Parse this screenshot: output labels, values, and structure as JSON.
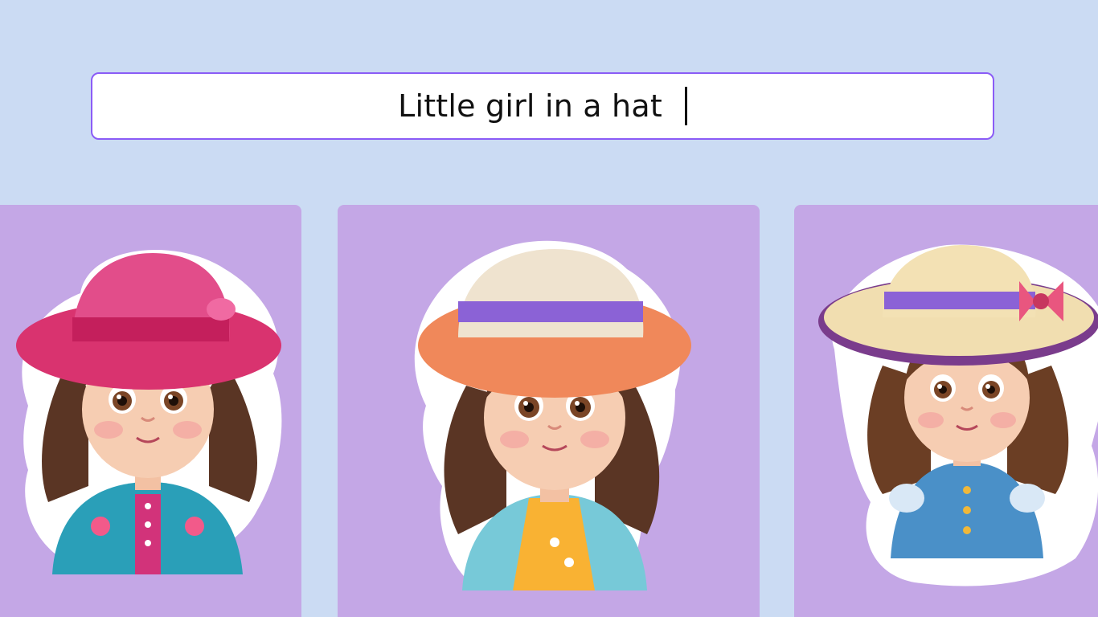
{
  "prompt": {
    "text": "Little girl in a hat"
  },
  "colors": {
    "background": "#cbdbf3",
    "prompt_border": "#8b5cf6",
    "card_background": "#c4a7e6"
  },
  "results": [
    {
      "icon": "girl-pink-hat-sticker"
    },
    {
      "icon": "girl-orange-hat-sticker"
    },
    {
      "icon": "girl-cream-hat-sticker"
    }
  ]
}
